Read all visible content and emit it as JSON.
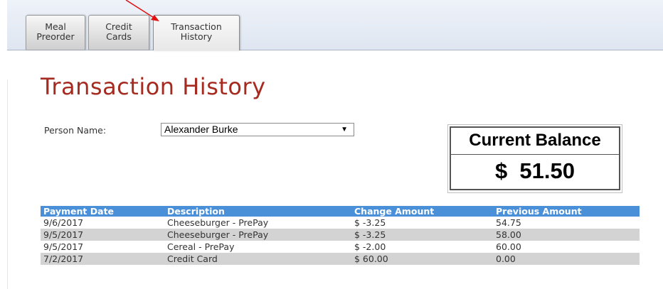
{
  "tabs": [
    {
      "line1": "Meal",
      "line2": "Preorder"
    },
    {
      "line1": "Credit",
      "line2": "Cards"
    },
    {
      "line1": "Transaction",
      "line2": "History"
    }
  ],
  "page_title": "Transaction History",
  "person": {
    "label": "Person Name:",
    "selected": "Alexander Burke"
  },
  "balance": {
    "label": "Current Balance",
    "value": "$  51.50"
  },
  "table": {
    "headers": [
      "Payment Date",
      "Description",
      "Change Amount",
      "Previous Amount"
    ],
    "rows": [
      [
        "9/6/2017",
        "Cheeseburger - PrePay",
        "$ -3.25",
        "54.75"
      ],
      [
        "9/5/2017",
        "Cheeseburger - PrePay",
        "$ -3.25",
        "58.00"
      ],
      [
        "9/5/2017",
        "Cereal - PrePay",
        "$ -2.00",
        "60.00"
      ],
      [
        "7/2/2017",
        "Credit Card",
        "$ 60.00",
        "0.00"
      ]
    ]
  },
  "colors": {
    "title": "#a52a1f",
    "header_bg": "#4a90d9",
    "row_alt_bg": "#d3d3d3",
    "arrow": "#e01010"
  },
  "icons": {
    "dropdown": "chevron-down-icon",
    "annotation": "red-arrow-icon"
  }
}
